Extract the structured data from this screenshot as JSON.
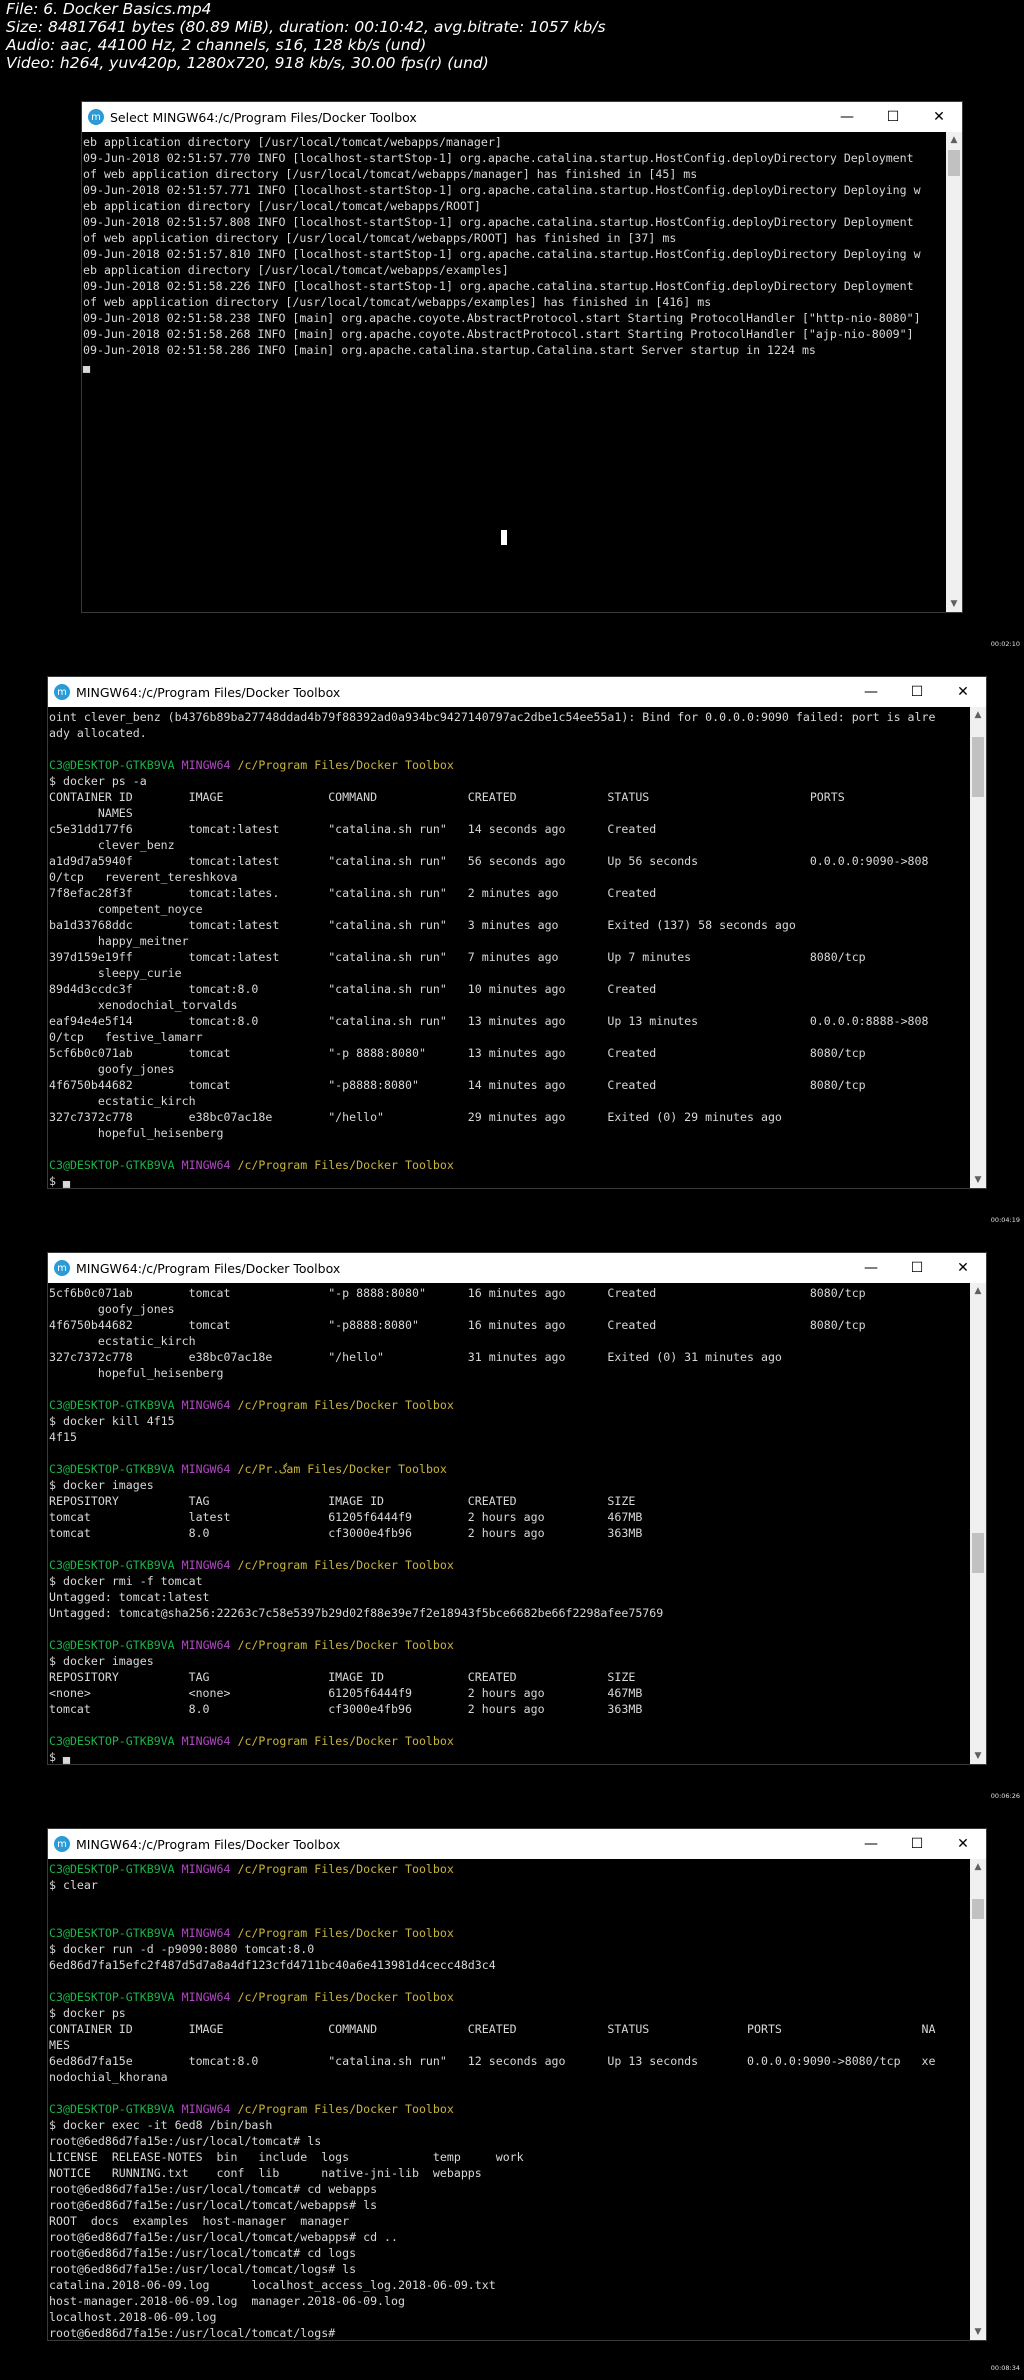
{
  "meta": {
    "file": "File: 6. Docker Basics.mp4",
    "size": "Size: 84817641 bytes (80.89 MiB), duration: 00:10:42, avg.bitrate: 1057 kb/s",
    "audio": "Audio: aac, 44100 Hz, 2 channels, s16, 128 kb/s (und)",
    "video": "Video: h264, yuv420p, 1280x720, 918 kb/s, 30.00 fps(r) (und)"
  },
  "windows": [
    {
      "title": "Select MINGW64:/c/Program Files/Docker Toolbox",
      "timestamp": "00:02:10",
      "lines": [
        [
          {
            "t": "eb application directory [/usr/local/tomcat/webapps/manager]"
          }
        ],
        [
          {
            "t": "09-Jun-2018 02:51:57.770 INFO [localhost-startStop-1] org.apache.catalina.startup.HostConfig.deployDirectory Deployment"
          }
        ],
        [
          {
            "t": "of web application directory [/usr/local/tomcat/webapps/manager] has finished in [45] ms"
          }
        ],
        [
          {
            "t": "09-Jun-2018 02:51:57.771 INFO [localhost-startStop-1] org.apache.catalina.startup.HostConfig.deployDirectory Deploying w"
          }
        ],
        [
          {
            "t": "eb application directory [/usr/local/tomcat/webapps/ROOT]"
          }
        ],
        [
          {
            "t": "09-Jun-2018 02:51:57.808 INFO [localhost-startStop-1] org.apache.catalina.startup.HostConfig.deployDirectory Deployment"
          }
        ],
        [
          {
            "t": "of web application directory [/usr/local/tomcat/webapps/ROOT] has finished in [37] ms"
          }
        ],
        [
          {
            "t": "09-Jun-2018 02:51:57.810 INFO [localhost-startStop-1] org.apache.catalina.startup.HostConfig.deployDirectory Deploying w"
          }
        ],
        [
          {
            "t": "eb application directory [/usr/local/tomcat/webapps/examples]"
          }
        ],
        [
          {
            "t": "09-Jun-2018 02:51:58.226 INFO [localhost-startStop-1] org.apache.catalina.startup.HostConfig.deployDirectory Deployment"
          }
        ],
        [
          {
            "t": "of web application directory [/usr/local/tomcat/webapps/examples] has finished in [416] ms"
          }
        ],
        [
          {
            "t": "09-Jun-2018 02:51:58.238 INFO [main] org.apache.coyote.AbstractProtocol.start Starting ProtocolHandler [\"http-nio-8080\"]"
          }
        ],
        [
          {
            "t": "09-Jun-2018 02:51:58.268 INFO [main] org.apache.coyote.AbstractProtocol.start Starting ProtocolHandler [\"ajp-nio-8009\"]"
          }
        ],
        [
          {
            "t": "09-Jun-2018 02:51:58.286 INFO [main] org.apache.catalina.startup.Catalina.start Server startup in 1224 ms"
          }
        ],
        [
          {
            "t": "▄"
          }
        ]
      ]
    },
    {
      "title": "MINGW64:/c/Program Files/Docker Toolbox",
      "timestamp": "00:04:19",
      "lines": [
        [
          {
            "t": "oint clever_benz (b4376b89ba27748ddad4b79f88392ad0a934bc9427140797ac2dbe1c54ee55a1): Bind for 0.0.0.0:9090 failed: port is alre"
          }
        ],
        [
          {
            "t": "ady allocated."
          }
        ],
        [
          {
            "t": ""
          }
        ],
        [
          {
            "t": "C3@DESKTOP-GTKB9VA ",
            "c": "green"
          },
          {
            "t": "MINGW64 ",
            "c": "mag"
          },
          {
            "t": "/c/Program Files/Docker Toolbox",
            "c": "yel"
          }
        ],
        [
          {
            "t": "$ docker ps -a"
          }
        ],
        [
          {
            "t": "CONTAINER ID        IMAGE               COMMAND             CREATED             STATUS                       PORTS"
          }
        ],
        [
          {
            "t": "       NAMES"
          }
        ],
        [
          {
            "t": "c5e31dd177f6        tomcat:latest       \"catalina.sh run\"   14 seconds ago      Created"
          }
        ],
        [
          {
            "t": "       clever_benz"
          }
        ],
        [
          {
            "t": "a1d9d7a5940f        tomcat:latest       \"catalina.sh run\"   56 seconds ago      Up 56 seconds                0.0.0.0:9090->808"
          }
        ],
        [
          {
            "t": "0/tcp   reverent_tereshkova"
          }
        ],
        [
          {
            "t": "7f8efac28f3f        tomcat:lates.       \"catalina.sh run\"   2 minutes ago       Created"
          }
        ],
        [
          {
            "t": "       competent_noyce"
          }
        ],
        [
          {
            "t": "ba1d33768ddc        tomcat:latest       \"catalina.sh run\"   3 minutes ago       Exited (137) 58 seconds ago"
          }
        ],
        [
          {
            "t": "       happy_meitner"
          }
        ],
        [
          {
            "t": "397d159e19ff        tomcat:latest       \"catalina.sh run\"   7 minutes ago       Up 7 minutes                 8080/tcp"
          }
        ],
        [
          {
            "t": "       sleepy_curie"
          }
        ],
        [
          {
            "t": "89d4d3ccdc3f        tomcat:8.0          \"catalina.sh run\"   10 minutes ago      Created"
          }
        ],
        [
          {
            "t": "       xenodochial_torvalds"
          }
        ],
        [
          {
            "t": "eaf94e4e5f14        tomcat:8.0          \"catalina.sh run\"   13 minutes ago      Up 13 minutes                0.0.0.0:8888->808"
          }
        ],
        [
          {
            "t": "0/tcp   festive_lamarr"
          }
        ],
        [
          {
            "t": "5cf6b0c071ab        tomcat              \"-p 8888:8080\"      13 minutes ago      Created                      8080/tcp"
          }
        ],
        [
          {
            "t": "       goofy_jones"
          }
        ],
        [
          {
            "t": "4f6750b44682        tomcat              \"-p8888:8080\"       14 minutes ago      Created                      8080/tcp"
          }
        ],
        [
          {
            "t": "       ecstatic_kirch"
          }
        ],
        [
          {
            "t": "327c7372c778        e38bc07ac18e        \"/hello\"            29 minutes ago      Exited (0) 29 minutes ago"
          }
        ],
        [
          {
            "t": "       hopeful_heisenberg"
          }
        ],
        [
          {
            "t": ""
          }
        ],
        [
          {
            "t": "C3@DESKTOP-GTKB9VA ",
            "c": "green"
          },
          {
            "t": "MINGW64 ",
            "c": "mag"
          },
          {
            "t": "/c/Program Files/Docker Toolbox",
            "c": "yel"
          }
        ],
        [
          {
            "t": "$ ▄"
          }
        ]
      ]
    },
    {
      "title": "MINGW64:/c/Program Files/Docker Toolbox",
      "timestamp": "00:06:26",
      "lines": [
        [
          {
            "t": "5cf6b0c071ab        tomcat              \"-p 8888:8080\"      16 minutes ago      Created                      8080/tcp"
          }
        ],
        [
          {
            "t": "       goofy_jones"
          }
        ],
        [
          {
            "t": "4f6750b44682        tomcat              \"-p8888:8080\"       16 minutes ago      Created                      8080/tcp"
          }
        ],
        [
          {
            "t": "       ecstatic_kirch"
          }
        ],
        [
          {
            "t": "327c7372c778        e38bc07ac18e        \"/hello\"            31 minutes ago      Exited (0) 31 minutes ago"
          }
        ],
        [
          {
            "t": "       hopeful_heisenberg"
          }
        ],
        [
          {
            "t": ""
          }
        ],
        [
          {
            "t": "C3@DESKTOP-GTKB9VA ",
            "c": "green"
          },
          {
            "t": "MINGW64 ",
            "c": "mag"
          },
          {
            "t": "/c/Program Files/Docker Toolbox",
            "c": "yel"
          }
        ],
        [
          {
            "t": "$ docker kill 4f15"
          }
        ],
        [
          {
            "t": "4f15"
          }
        ],
        [
          {
            "t": ""
          }
        ],
        [
          {
            "t": "C3@DESKTOP-GTKB9VA ",
            "c": "green"
          },
          {
            "t": "MINGW64 ",
            "c": "mag"
          },
          {
            "t": "/c/Pr.گam Files/Docker Toolbox",
            "c": "yel"
          }
        ],
        [
          {
            "t": "$ docker images"
          }
        ],
        [
          {
            "t": "REPOSITORY          TAG                 IMAGE ID            CREATED             SIZE"
          }
        ],
        [
          {
            "t": "tomcat              latest              61205f6444f9        2 hours ago         467MB"
          }
        ],
        [
          {
            "t": "tomcat              8.0                 cf3000e4fb96        2 hours ago         363MB"
          }
        ],
        [
          {
            "t": ""
          }
        ],
        [
          {
            "t": "C3@DESKTOP-GTKB9VA ",
            "c": "green"
          },
          {
            "t": "MINGW64 ",
            "c": "mag"
          },
          {
            "t": "/c/Program Files/Docker Toolbox",
            "c": "yel"
          }
        ],
        [
          {
            "t": "$ docker rmi -f tomcat"
          }
        ],
        [
          {
            "t": "Untagged: tomcat:latest"
          }
        ],
        [
          {
            "t": "Untagged: tomcat@sha256:22263c7c58e5397b29d02f88e39e7f2e18943f5bce6682be66f2298afee75769"
          }
        ],
        [
          {
            "t": ""
          }
        ],
        [
          {
            "t": "C3@DESKTOP-GTKB9VA ",
            "c": "green"
          },
          {
            "t": "MINGW64 ",
            "c": "mag"
          },
          {
            "t": "/c/Program Files/Docker Toolbox",
            "c": "yel"
          }
        ],
        [
          {
            "t": "$ docker images"
          }
        ],
        [
          {
            "t": "REPOSITORY          TAG                 IMAGE ID            CREATED             SIZE"
          }
        ],
        [
          {
            "t": "<none>              <none>              61205f6444f9        2 hours ago         467MB"
          }
        ],
        [
          {
            "t": "tomcat              8.0                 cf3000e4fb96        2 hours ago         363MB"
          }
        ],
        [
          {
            "t": ""
          }
        ],
        [
          {
            "t": "C3@DESKTOP-GTKB9VA ",
            "c": "green"
          },
          {
            "t": "MINGW64 ",
            "c": "mag"
          },
          {
            "t": "/c/Program Files/Docker Toolbox",
            "c": "yel"
          }
        ],
        [
          {
            "t": "$ ▄"
          }
        ]
      ]
    },
    {
      "title": "MINGW64:/c/Program Files/Docker Toolbox",
      "timestamp": "00:08:34",
      "lines": [
        [
          {
            "t": "C3@DESKTOP-GTKB9VA ",
            "c": "green"
          },
          {
            "t": "MINGW64 ",
            "c": "mag"
          },
          {
            "t": "/c/Program Files/Docker Toolbox",
            "c": "yel"
          }
        ],
        [
          {
            "t": "$ clear"
          }
        ],
        [
          {
            "t": ""
          }
        ],
        [
          {
            "t": ""
          }
        ],
        [
          {
            "t": "C3@DESKTOP-GTKB9VA ",
            "c": "green"
          },
          {
            "t": "MINGW64 ",
            "c": "mag"
          },
          {
            "t": "/c/Program Files/Docker Toolbox",
            "c": "yel"
          }
        ],
        [
          {
            "t": "$ docker run -d -p9090:8080 tomcat:8.0"
          }
        ],
        [
          {
            "t": "6ed86d7fa15efc2f487d5d7a8a4df123cfd4711bc40a6e413981d4cecc48d3c4"
          }
        ],
        [
          {
            "t": ""
          }
        ],
        [
          {
            "t": "C3@DESKTOP-GTKB9VA ",
            "c": "green"
          },
          {
            "t": "MINGW64 ",
            "c": "mag"
          },
          {
            "t": "/c/Program Files/Docker Toolbox",
            "c": "yel"
          }
        ],
        [
          {
            "t": "$ docker ps"
          }
        ],
        [
          {
            "t": "CONTAINER ID        IMAGE               COMMAND             CREATED             STATUS              PORTS                    NA"
          }
        ],
        [
          {
            "t": "MES"
          }
        ],
        [
          {
            "t": "6ed86d7fa15e        tomcat:8.0          \"catalina.sh run\"   12 seconds ago      Up 13 seconds       0.0.0.0:9090->8080/tcp   xe"
          }
        ],
        [
          {
            "t": "nodochial_khorana"
          }
        ],
        [
          {
            "t": ""
          }
        ],
        [
          {
            "t": "C3@DESKTOP-GTKB9VA ",
            "c": "green"
          },
          {
            "t": "MINGW64 ",
            "c": "mag"
          },
          {
            "t": "/c/Program Files/Docker Toolbox",
            "c": "yel"
          }
        ],
        [
          {
            "t": "$ docker exec -it 6ed8 /bin/bash"
          }
        ],
        [
          {
            "t": "root@6ed86d7fa15e:/usr/local/tomcat# ls"
          }
        ],
        [
          {
            "t": "LICENSE  RELEASE-NOTES  bin   include  logs            temp     work"
          }
        ],
        [
          {
            "t": "NOTICE   RUNNING.txt    conf  lib      native-jni-lib  webapps"
          }
        ],
        [
          {
            "t": "root@6ed86d7fa15e:/usr/local/tomcat# cd webapps"
          }
        ],
        [
          {
            "t": "root@6ed86d7fa15e:/usr/local/tomcat/webapps# ls"
          }
        ],
        [
          {
            "t": "ROOT  docs  examples  host-manager  manager"
          }
        ],
        [
          {
            "t": "root@6ed86d7fa15e:/usr/local/tomcat/webapps# cd .."
          }
        ],
        [
          {
            "t": "root@6ed86d7fa15e:/usr/local/tomcat# cd logs"
          }
        ],
        [
          {
            "t": "root@6ed86d7fa15e:/usr/local/tomcat/logs# ls"
          }
        ],
        [
          {
            "t": "catalina.2018-06-09.log      localhost_access_log.2018-06-09.txt"
          }
        ],
        [
          {
            "t": "host-manager.2018-06-09.log  manager.2018-06-09.log"
          }
        ],
        [
          {
            "t": "localhost.2018-06-09.log"
          }
        ],
        [
          {
            "t": "root@6ed86d7fa15e:/usr/local/tomcat/logs#"
          }
        ]
      ]
    }
  ],
  "controls": {
    "minimize": "—",
    "maximize": "☐",
    "close": "✕",
    "scroll_up": "▲",
    "scroll_down": "▼"
  }
}
